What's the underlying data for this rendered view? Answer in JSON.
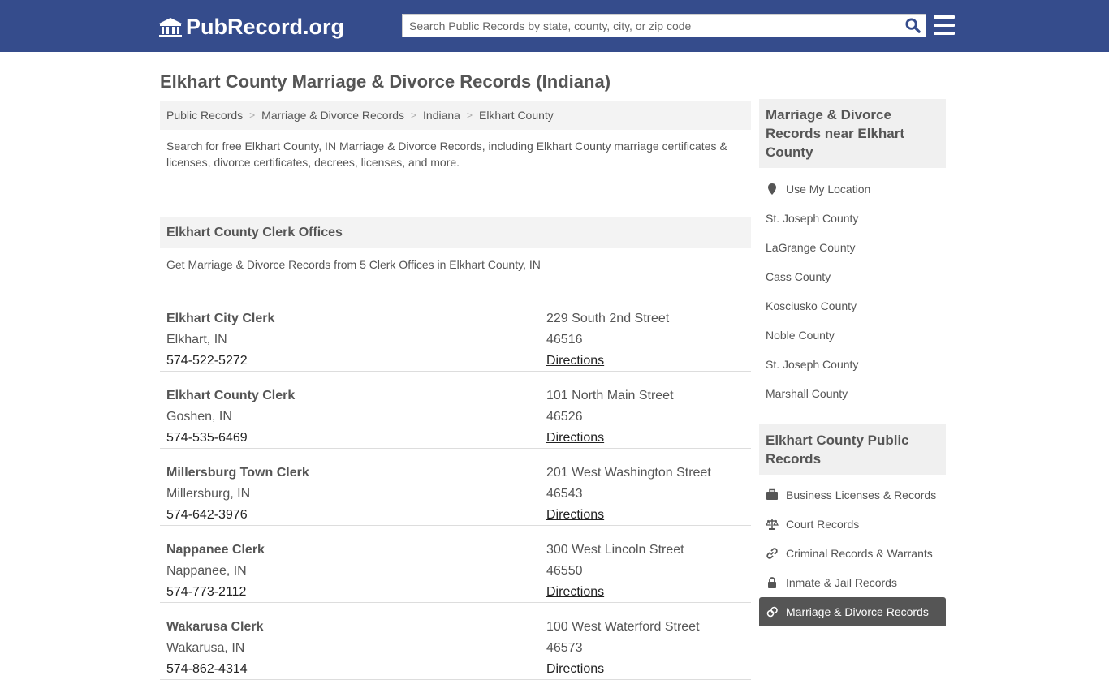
{
  "header": {
    "logo": "PubRecord.org",
    "search_placeholder": "Search Public Records by state, county, city, or zip code"
  },
  "page_title": "Elkhart County Marriage & Divorce Records (Indiana)",
  "breadcrumbs": [
    "Public Records",
    "Marriage & Divorce Records",
    "Indiana",
    "Elkhart County"
  ],
  "intro": "Search for free Elkhart County, IN Marriage & Divorce Records, including Elkhart County marriage certificates & licenses, divorce certificates, decrees, licenses, and more.",
  "section_title": "Elkhart County Clerk Offices",
  "section_sub": "Get Marriage & Divorce Records from 5 Clerk Offices in Elkhart County, IN",
  "offices": [
    {
      "name": "Elkhart City Clerk",
      "city": "Elkhart, IN",
      "phone": "574-522-5272",
      "street": "229 South 2nd Street",
      "zip": "46516",
      "directions": "Directions"
    },
    {
      "name": "Elkhart County Clerk",
      "city": "Goshen, IN",
      "phone": "574-535-6469",
      "street": "101 North Main Street",
      "zip": "46526",
      "directions": "Directions"
    },
    {
      "name": "Millersburg Town Clerk",
      "city": "Millersburg, IN",
      "phone": "574-642-3976",
      "street": "201 West Washington Street",
      "zip": "46543",
      "directions": "Directions"
    },
    {
      "name": "Nappanee Clerk",
      "city": "Nappanee, IN",
      "phone": "574-773-2112",
      "street": "300 West Lincoln Street",
      "zip": "46550",
      "directions": "Directions"
    },
    {
      "name": "Wakarusa Clerk",
      "city": "Wakarusa, IN",
      "phone": "574-862-4314",
      "street": "100 West Waterford Street",
      "zip": "46573",
      "directions": "Directions"
    }
  ],
  "sidebar": {
    "nearby_title": "Marriage & Divorce Records near Elkhart County",
    "use_location": "Use My Location",
    "nearby": [
      "St. Joseph County",
      "LaGrange County",
      "Cass County",
      "Kosciusko County",
      "Noble County",
      "St. Joseph County",
      "Marshall County"
    ],
    "public_title": "Elkhart County Public Records",
    "public": [
      {
        "label": "Business Licenses & Records",
        "icon": "briefcase-icon"
      },
      {
        "label": "Court Records",
        "icon": "scales-icon"
      },
      {
        "label": "Criminal Records & Warrants",
        "icon": "link-icon"
      },
      {
        "label": "Inmate & Jail Records",
        "icon": "lock-icon"
      },
      {
        "label": "Marriage & Divorce Records",
        "icon": "rings-icon"
      }
    ]
  }
}
